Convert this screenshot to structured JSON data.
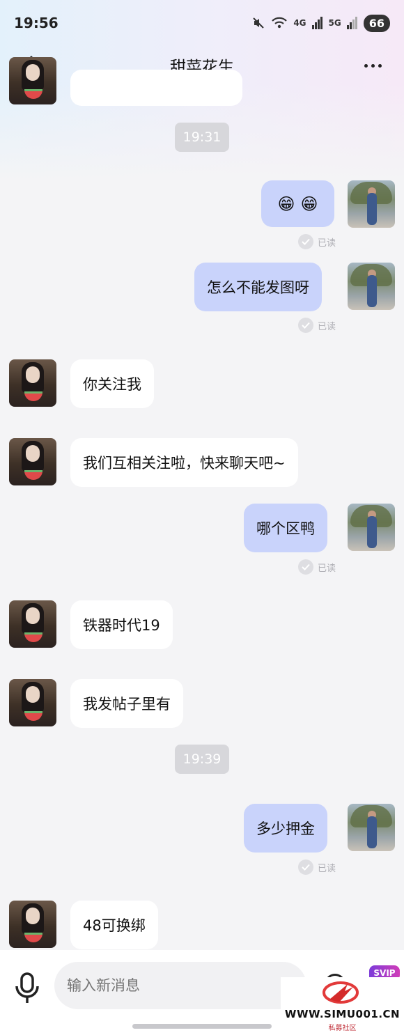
{
  "status_bar": {
    "time": "19:56",
    "network_1": "4G",
    "network_2": "5G",
    "battery": "66"
  },
  "header": {
    "title": "甜菜花生"
  },
  "messages": {
    "time_1": "19:31",
    "self_1_emoji": [
      "😁",
      "😁"
    ],
    "self_1_status": "已读",
    "self_2": "怎么不能发图呀",
    "self_2_status": "已读",
    "other_1": "你关注我",
    "other_2": "我们互相关注啦，快来聊天吧~",
    "self_3": "哪个区鸭",
    "self_3_status": "已读",
    "other_3": "铁器时代19",
    "other_4": "我发帖子里有",
    "time_2": "19:39",
    "self_4": "多少押金",
    "self_4_status": "已读",
    "other_5": "48可换绑"
  },
  "input_bar": {
    "placeholder": "输入新消息",
    "svip_label": "SVIP"
  },
  "watermark": {
    "url": "WWW.SIMU001.CN",
    "subtitle": "私募社区"
  },
  "icons": {
    "back": "chevron-left-icon",
    "more": "more-dots-icon",
    "mic": "microphone-icon",
    "emoji": "emoji-icon",
    "read": "check-circle-icon"
  },
  "colors": {
    "self_bubble": "#c9d3fb",
    "other_bubble": "#ffffff",
    "background": "#f4f4f6"
  }
}
